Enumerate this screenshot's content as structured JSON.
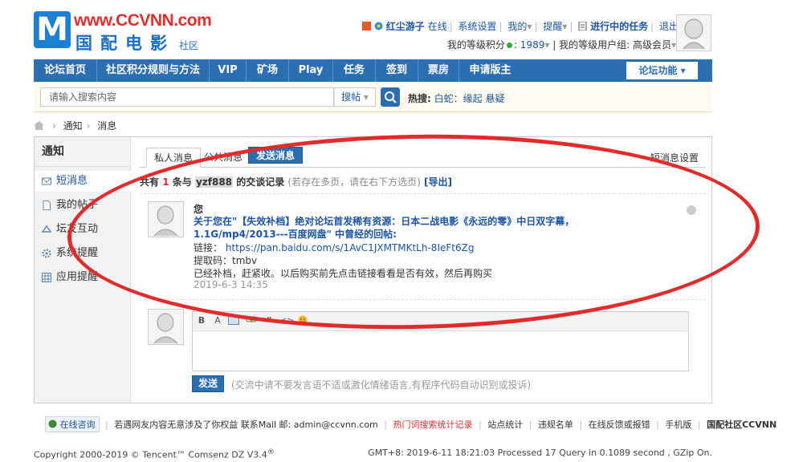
{
  "logo": {
    "url_text": "www.CCVNN.com",
    "cn_text": "国配电影",
    "suffix": "社区"
  },
  "userbar": {
    "username": "红尘游子",
    "online": "在线",
    "settings": "系统设置",
    "mine": "我的",
    "remind": "提醒",
    "tasks": "进行中的任务",
    "logout": "退出",
    "points_label": "我的等级积分",
    "points_value": "1989",
    "group_label": "我的等级用户组:",
    "group_value": "高级会员"
  },
  "nav": {
    "items": [
      "论坛首页",
      "社区积分规则与方法",
      "VIP",
      "矿场",
      "Play",
      "任务",
      "签到",
      "票房",
      "申请版主"
    ],
    "function_label": "论坛功能"
  },
  "search": {
    "placeholder": "请输入搜索内容",
    "type": "搜帖",
    "hot_label": "热搜:",
    "hot_items": [
      "白蛇：缘起",
      "悬疑"
    ]
  },
  "breadcrumb": {
    "items": [
      "通知",
      "消息"
    ]
  },
  "sidebar": {
    "title": "通知",
    "items": [
      {
        "label": "短消息",
        "icon": "envelope-icon",
        "active": true
      },
      {
        "label": "我的帖子",
        "icon": "document-icon"
      },
      {
        "label": "坛友互动",
        "icon": "interaction-icon"
      },
      {
        "label": "系统提醒",
        "icon": "gear-icon"
      },
      {
        "label": "应用提醒",
        "icon": "grid-icon"
      }
    ]
  },
  "tabs": {
    "private": "私人消息",
    "public": "公共消息",
    "send": "发送消息",
    "settings": "短消息设置"
  },
  "summary": {
    "prefix": "共有",
    "count": "1",
    "mid": "条与",
    "user": "yzf888",
    "suffix": "的交谈记录",
    "hint": "(若存在多页，请在右下方选页)",
    "export": "[导出]"
  },
  "message": {
    "from": "您",
    "title": "关于您在\"【失效补档】绝对论坛首发稀有资源：日本二战电影《永远的零》中日双字幕，1.1G/mp4/2013---百度网盘\" 中曾经的回帖:",
    "link_label": "链接：",
    "link": "https://pan.baidu.com/s/1AvC1JXMTMKtLh-8IeFt6Zg",
    "code": "提取码：tmbv",
    "reply": "已经补档，赶紧收。以后购买前先点击链接看看是否有效，然后再购买",
    "time": "2019-6-3 14:35"
  },
  "reply_box": {
    "send_label": "发送",
    "hint": "(交流中请不要发言语不适或激化情绪语言,有程序代码自动识别或投诉)"
  },
  "footer": {
    "consult": "在线咨询",
    "notice": "若遇网友内容无意涉及了你权益 联系Mail 邮:",
    "email": "admin@ccvnn.com",
    "hot_stats": "热门词搜索统计记录",
    "links": [
      "站点统计",
      "违规名单",
      "在线反馈或报错",
      "手机版"
    ],
    "brand": "国配社区CCVNN",
    "copyright": "Copyright 2000-2019 © Tencent™ Comsenz DZ V3.4",
    "copyright_mark": "®",
    "stats": "GMT+8:  2019-6-11 18:21:03   Processed 17 Query in 0.1089 second , GZip On."
  },
  "colors": {
    "nav_bg": "#2b6fb3",
    "link": "#1b55a4",
    "annotation": "#e32b2b"
  }
}
